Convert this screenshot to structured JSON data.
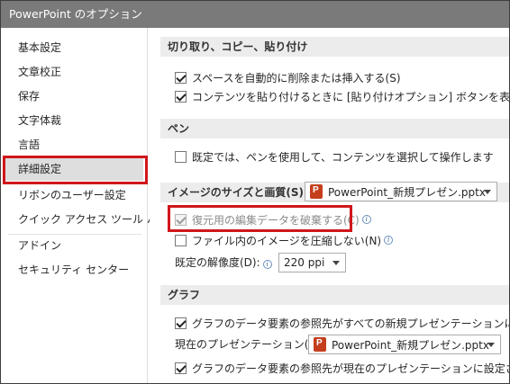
{
  "window": {
    "title": "PowerPoint のオプション"
  },
  "sidebar": {
    "items": [
      {
        "label": "基本設定"
      },
      {
        "label": "文章校正"
      },
      {
        "label": "保存"
      },
      {
        "label": "文字体裁"
      },
      {
        "label": "言語"
      },
      {
        "label": "詳細設定",
        "selected": true
      },
      {
        "label": "リボンのユーザー設定"
      },
      {
        "label": "クイック アクセス ツール バー"
      },
      {
        "label": "アドイン"
      },
      {
        "label": "セキュリティ センター"
      }
    ]
  },
  "sections": {
    "clipboard": {
      "header": "切り取り、コピー、貼り付け",
      "smart_cut": {
        "label": "スペースを自動的に削除または挿入する(S)",
        "checked": true
      },
      "paste_options": {
        "label": "コンテンツを貼り付けるときに [貼り付けオプション] ボタンを表示する(H)",
        "checked": true
      }
    },
    "pen": {
      "header": "ペン",
      "use_pen": {
        "label": "既定では、ペンを使用して、コンテンツを選択して操作します",
        "checked": false
      }
    },
    "image": {
      "header": "イメージのサイズと画質(S)",
      "file_dropdown": {
        "value": "PowerPoint_新規プレゼン.pptx"
      },
      "discard_edit_data": {
        "label": "復元用の編集データを破棄する(C)",
        "checked": true,
        "disabled": true
      },
      "no_compress": {
        "label": "ファイル内のイメージを圧縮しない(N)",
        "checked": false
      },
      "resolution": {
        "label": "既定の解像度(D):",
        "value": "220 ppi"
      }
    },
    "chart": {
      "header": "グラフ",
      "all_new": {
        "label": "グラフのデータ要素の参照先がすべての新規プレゼンテーションに設定されてい",
        "checked": true
      },
      "current_label": "現在のプレゼンテーション(C):",
      "current_dropdown": {
        "value": "PowerPoint_新規プレゼン.pptx"
      },
      "current_ref": {
        "label": "グラフのデータ要素の参照先が現在のプレゼンテーションに設定されているプロ",
        "checked": true
      }
    }
  },
  "colors": {
    "highlight": "#d0161b",
    "titlebar": "#7a7a7a",
    "selected": "#dedede"
  }
}
